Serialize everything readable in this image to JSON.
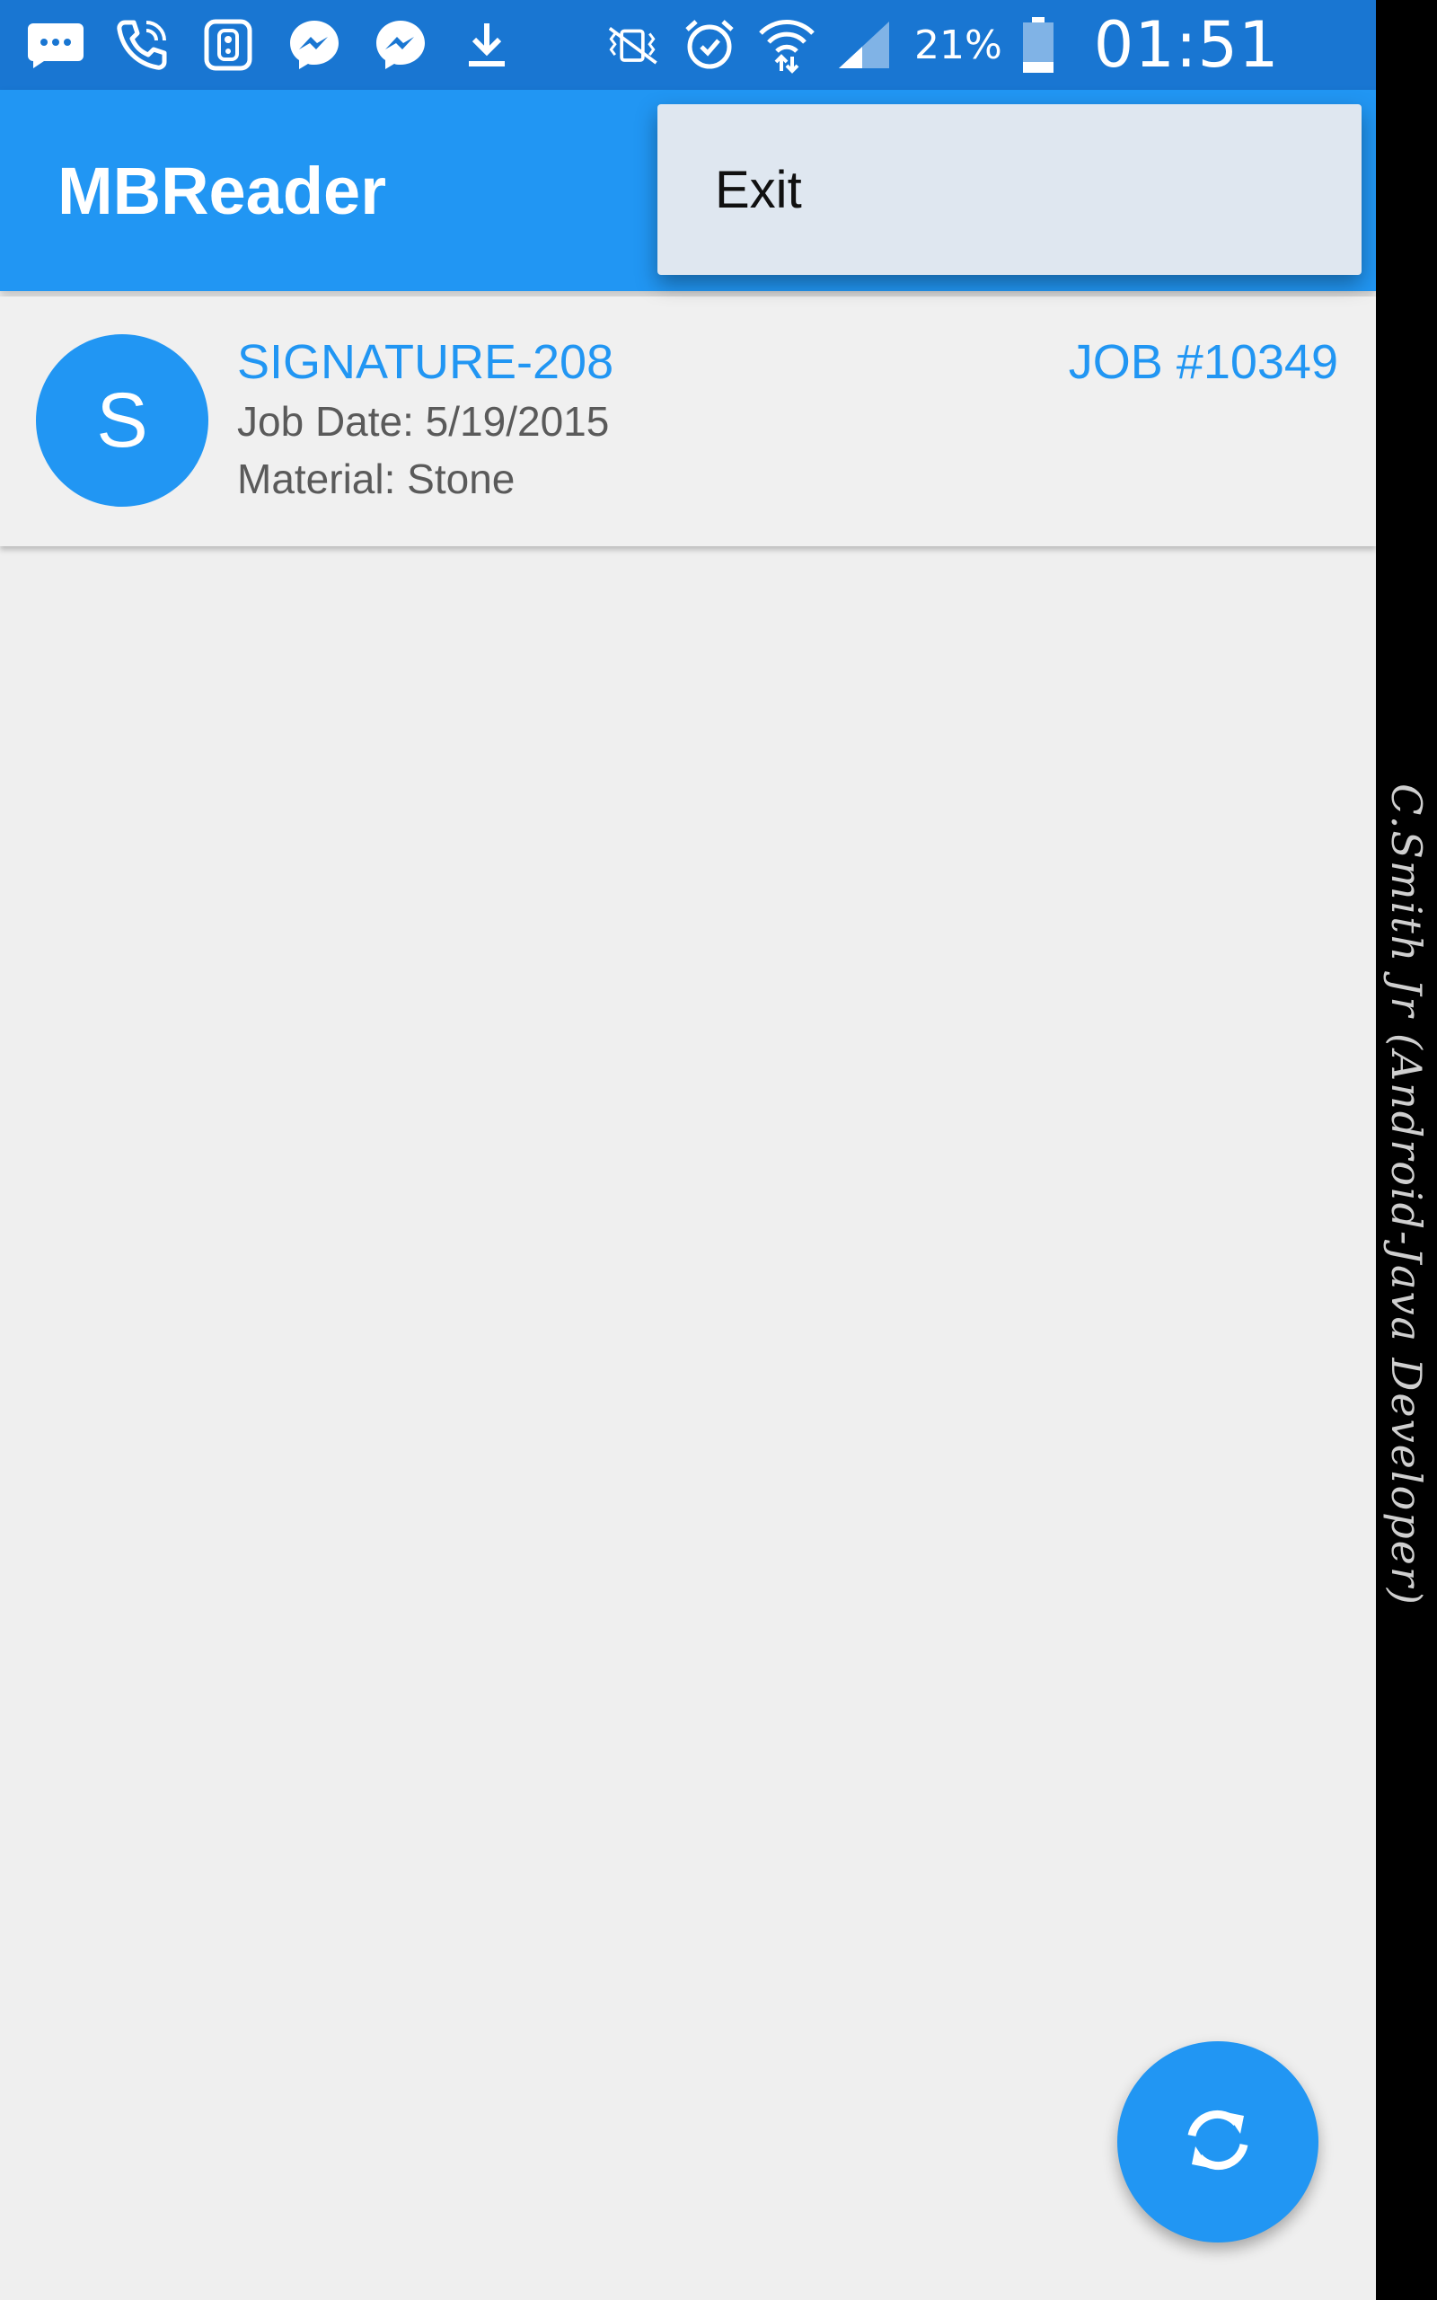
{
  "status_bar": {
    "left_icons": [
      "message-icon",
      "phone-wifi-call-icon",
      "remote-icon",
      "messenger-icon",
      "messenger-icon",
      "download-icon"
    ],
    "right_icons": [
      "vibrate-off-icon",
      "alarm-icon",
      "wifi-icon",
      "cell-signal-icon",
      "battery-icon"
    ],
    "battery_percent": "21%",
    "time": "01:51"
  },
  "app_bar": {
    "title": "MBReader"
  },
  "overflow_menu": {
    "items": [
      {
        "label": "Exit"
      }
    ]
  },
  "job_list": [
    {
      "avatar_letter": "S",
      "name": "SIGNATURE-208",
      "job_number": "JOB #10349",
      "date": "Job Date: 5/19/2015",
      "material": "Material: Stone"
    }
  ],
  "fab": {
    "icon": "sync-icon"
  },
  "colors": {
    "status_bar": "#1976d2",
    "app_bar": "#2196f3",
    "accent": "#2196f3",
    "background": "#efefef"
  },
  "watermark": "C.Smith Jr (Android-Java Developer)"
}
